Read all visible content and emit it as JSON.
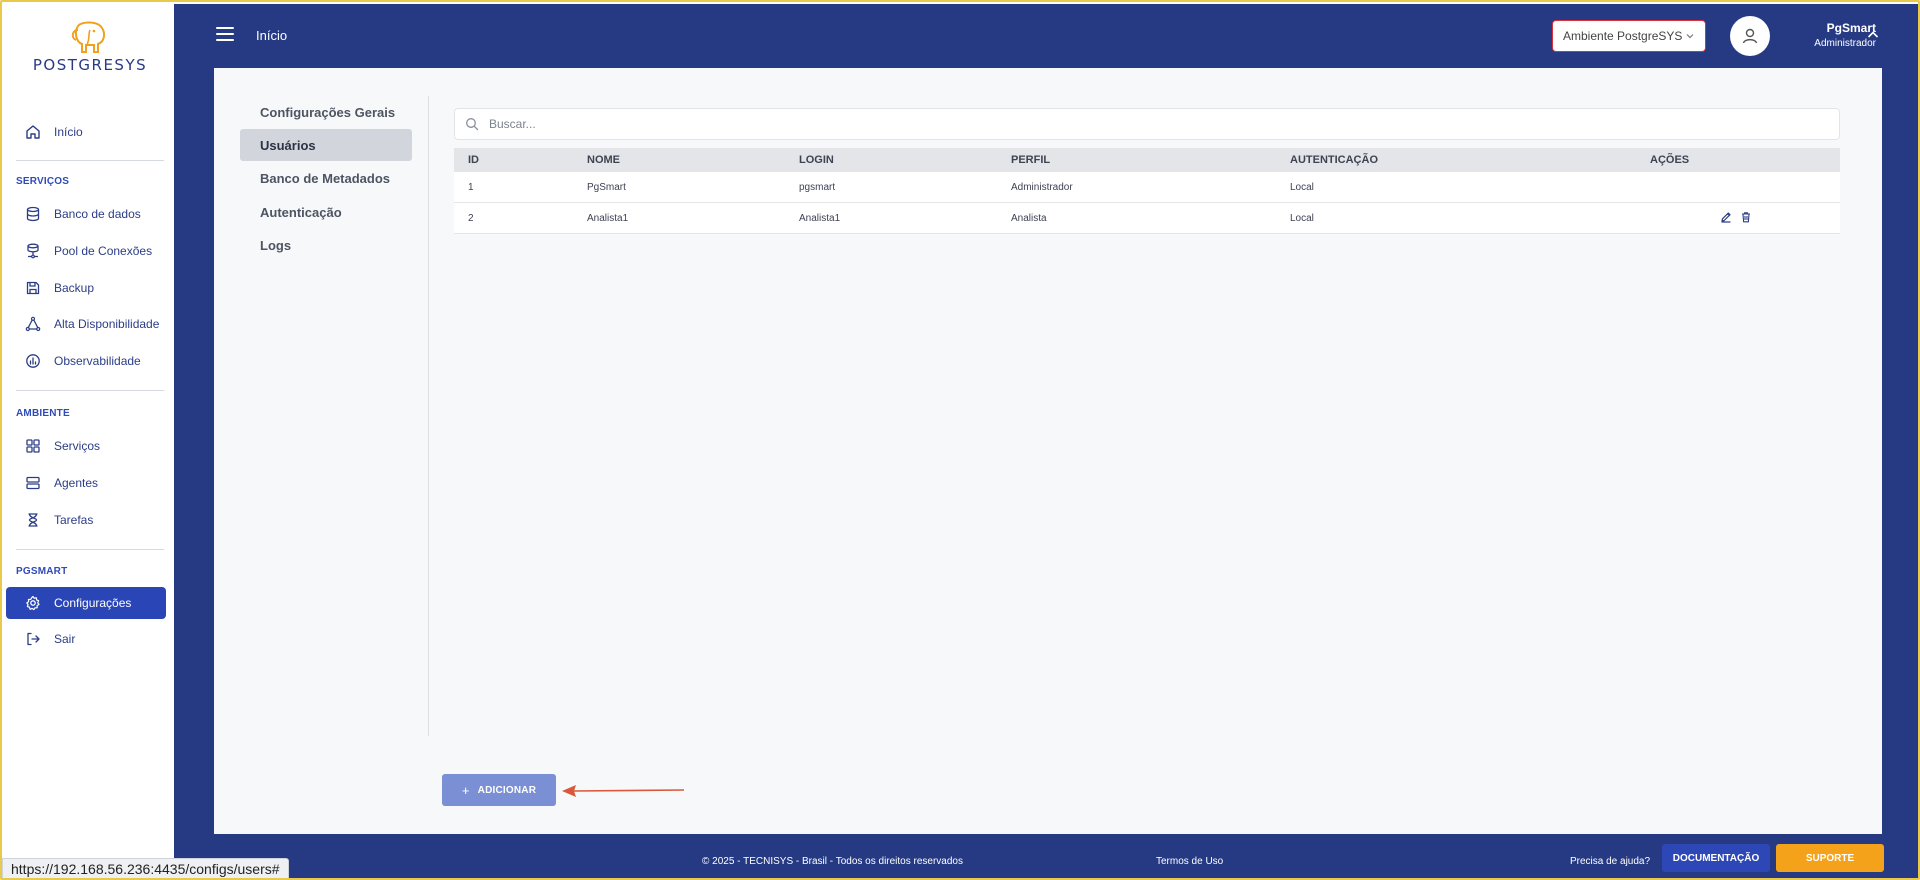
{
  "logo": {
    "text": "POSTGRESYS"
  },
  "sidebar": {
    "home": "Início",
    "sections": [
      {
        "label": "SERVIÇOS",
        "items": [
          "Banco de dados",
          "Pool de Conexões",
          "Backup",
          "Alta Disponibilidade",
          "Observabilidade"
        ]
      },
      {
        "label": "AMBIENTE",
        "items": [
          "Serviços",
          "Agentes",
          "Tarefas"
        ]
      },
      {
        "label": "PGSMART",
        "items": [
          "Configurações",
          "Sair"
        ]
      }
    ],
    "active_item": "Configurações"
  },
  "topbar": {
    "breadcrumb": "Início",
    "environment": "Ambiente PostgreSYS",
    "user_name": "PgSmart",
    "user_role": "Administrador"
  },
  "settings_nav": {
    "items": [
      "Configurações Gerais",
      "Usuários",
      "Banco de Metadados",
      "Autenticação",
      "Logs"
    ],
    "active": "Usuários"
  },
  "search": {
    "placeholder": "Buscar..."
  },
  "users_table": {
    "headers": [
      "ID",
      "NOME",
      "LOGIN",
      "PERFIL",
      "AUTENTICAÇÃO",
      "AÇÕES"
    ],
    "rows": [
      {
        "id": "1",
        "name": "PgSmart",
        "login": "pgsmart",
        "profile": "Administrador",
        "auth": "Local",
        "actions": []
      },
      {
        "id": "2",
        "name": "Analista1",
        "login": "Analista1",
        "profile": "Analista",
        "auth": "Local",
        "actions": [
          "edit-icon",
          "trash-icon"
        ]
      }
    ]
  },
  "add_button": {
    "label": "ADICIONAR"
  },
  "footer": {
    "copyright": "© 2025 - TECNISYS - Brasil - Todos os direitos reservados",
    "terms": "Termos de Uso",
    "help": "Precisa de ajuda?",
    "doc_button": "DOCUMENTAÇÃO",
    "support_button": "SUPORTE"
  },
  "status_bar": {
    "url": "https://192.168.56.236:4435/configs/users#"
  },
  "colors": {
    "primary_dark": "#263a84",
    "active_nav": "#2a46b6",
    "add_button": "#7a8fd4",
    "support_button": "#f5a21b",
    "env_border": "#d9303a",
    "annotation_arrow": "#d9583a"
  }
}
